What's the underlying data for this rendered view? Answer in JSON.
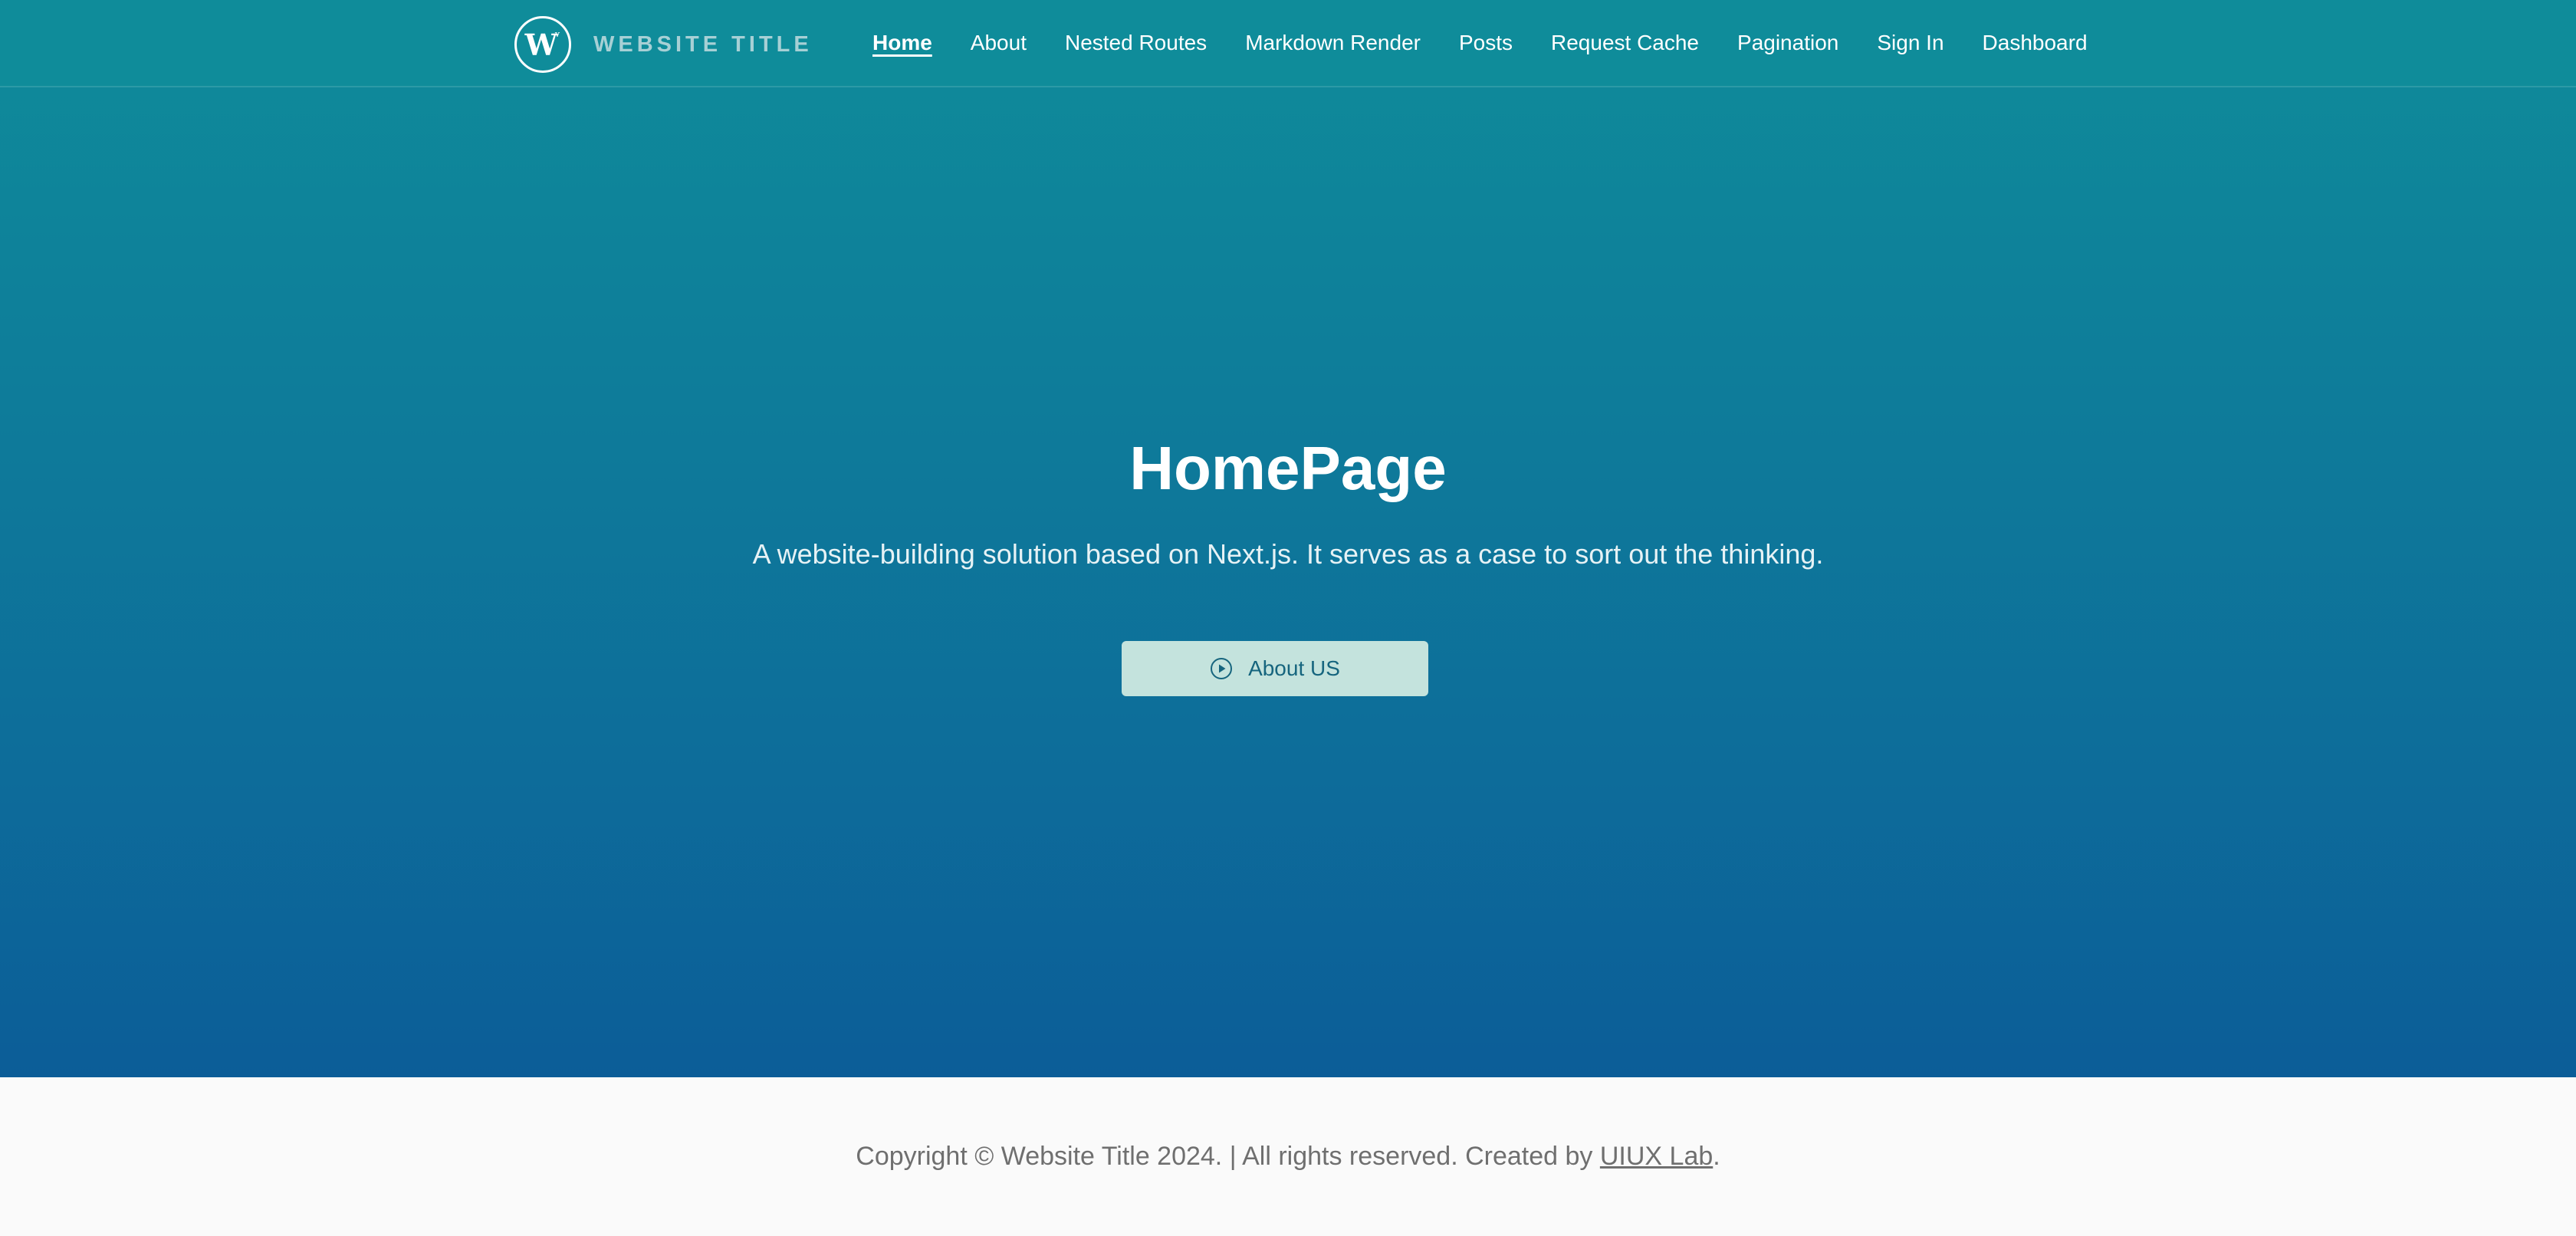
{
  "brand": {
    "title": "WEBSITE TITLE",
    "logo_icon": "w-logo-icon"
  },
  "nav": {
    "items": [
      {
        "label": "Home",
        "active": true
      },
      {
        "label": "About"
      },
      {
        "label": "Nested Routes"
      },
      {
        "label": "Markdown Render"
      },
      {
        "label": "Posts"
      },
      {
        "label": "Request Cache"
      },
      {
        "label": "Pagination"
      },
      {
        "label": "Sign In"
      },
      {
        "label": "Dashboard"
      }
    ]
  },
  "hero": {
    "title": "HomePage",
    "subtitle": "A website-building solution based on Next.js. It serves as a case to sort out the thinking.",
    "cta_label": "About US",
    "cta_icon": "play-circle-icon"
  },
  "footer": {
    "prefix": "Copyright © Website Title 2024. | All rights reserved. Created by ",
    "link": "UIUX Lab",
    "suffix": "."
  },
  "colors": {
    "hero_top": "#0f8c9a",
    "hero_bottom": "#0c5d98",
    "cta_bg": "#c4e3dd",
    "cta_text": "#16657e",
    "footer_bg": "#fafafa",
    "footer_text": "#6f6f6f"
  }
}
